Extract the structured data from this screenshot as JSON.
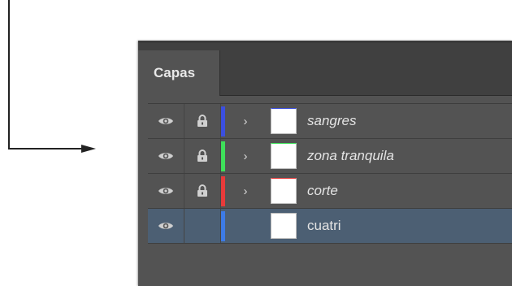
{
  "panel": {
    "tab_label": "Capas"
  },
  "layers": [
    {
      "name": "sangres",
      "color": "#3b4fe0",
      "locked": true,
      "expandable": true,
      "italic": true,
      "selected": false
    },
    {
      "name": "zona tranquila",
      "color": "#3ee05a",
      "locked": true,
      "expandable": true,
      "italic": true,
      "selected": false
    },
    {
      "name": "corte",
      "color": "#e83a3a",
      "locked": true,
      "expandable": true,
      "italic": true,
      "selected": false
    },
    {
      "name": "cuatri",
      "color": "#3d7be6",
      "locked": false,
      "expandable": false,
      "italic": false,
      "selected": true
    }
  ],
  "icons": {
    "visibility": "eye-icon",
    "lock": "lock-icon",
    "expand": "chevron-right-icon"
  }
}
